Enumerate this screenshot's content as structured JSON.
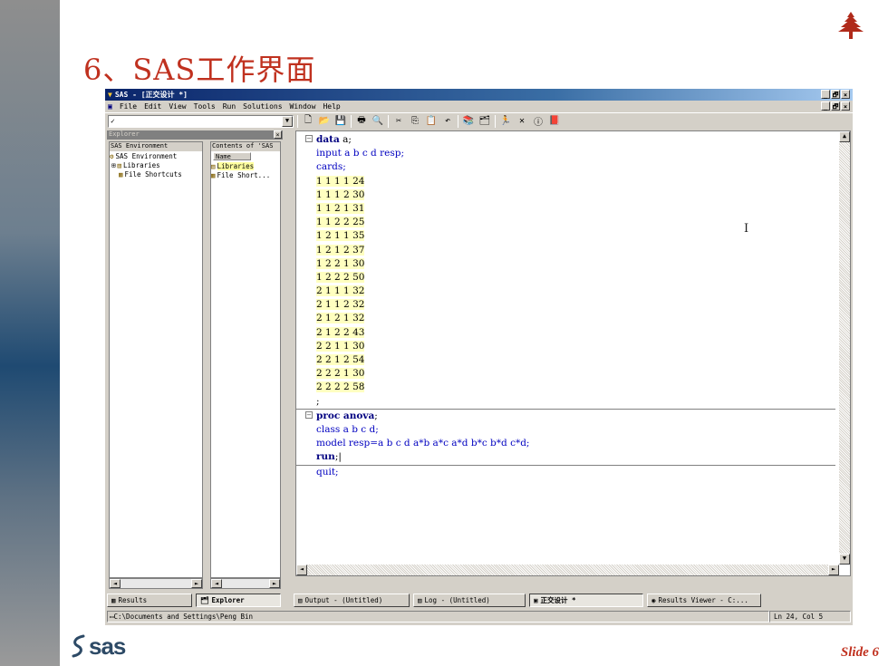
{
  "slide": {
    "title": "6、SAS工作界面",
    "slide_number": "Slide 6",
    "logo_text": "sas",
    "accent_color": "#c0311f"
  },
  "window": {
    "title": "SAS - [正交设计 *]",
    "buttons": [
      "_",
      "🗗",
      "×"
    ],
    "menu": [
      "File",
      "Edit",
      "View",
      "Tools",
      "Run",
      "Solutions",
      "Window",
      "Help"
    ],
    "command_box_value": "✓",
    "toolbar_icons": [
      "new-icon",
      "open-icon",
      "save-icon",
      "print-icon",
      "print-preview-icon",
      "cut-icon",
      "copy-icon",
      "paste-icon",
      "undo-icon",
      "libraries-icon",
      "explorer-icon",
      "run-icon",
      "clear-icon",
      "help-icon",
      "book-icon"
    ]
  },
  "explorer": {
    "title": "Explorer",
    "left_pane_header": "SAS Environment",
    "right_pane_header": "Contents of 'SAS",
    "column_name": "Name",
    "tree": [
      {
        "label": "SAS Environment"
      },
      {
        "label": "Libraries"
      },
      {
        "label": "File Shortcuts"
      }
    ],
    "contents": [
      {
        "label": "Libraries"
      },
      {
        "label": "File Short..."
      }
    ]
  },
  "editor": {
    "lines": [
      {
        "fold": "⊟",
        "parts": [
          {
            "t": "data",
            "c": "kw"
          },
          {
            "t": " a;",
            "c": ""
          }
        ]
      },
      {
        "fold": "",
        "parts": [
          {
            "t": "input a b c d resp;",
            "c": "st"
          }
        ]
      },
      {
        "fold": "",
        "parts": [
          {
            "t": "cards;",
            "c": "st"
          }
        ]
      },
      {
        "fold": "",
        "parts": [
          {
            "t": "1 1 1 1 24",
            "c": "dl"
          }
        ]
      },
      {
        "fold": "",
        "parts": [
          {
            "t": "1 1 1 2 30",
            "c": "dl"
          }
        ]
      },
      {
        "fold": "",
        "parts": [
          {
            "t": "1 1 2 1 31",
            "c": "dl"
          }
        ]
      },
      {
        "fold": "",
        "parts": [
          {
            "t": "1 1 2 2 25",
            "c": "dl"
          }
        ]
      },
      {
        "fold": "",
        "parts": [
          {
            "t": "1 2 1 1 35",
            "c": "dl"
          }
        ]
      },
      {
        "fold": "",
        "parts": [
          {
            "t": "1 2 1 2 37",
            "c": "dl"
          }
        ]
      },
      {
        "fold": "",
        "parts": [
          {
            "t": "1 2 2 1 30",
            "c": "dl"
          }
        ]
      },
      {
        "fold": "",
        "parts": [
          {
            "t": "1 2 2 2 50",
            "c": "dl"
          }
        ]
      },
      {
        "fold": "",
        "parts": [
          {
            "t": "2 1 1 1 32",
            "c": "dl"
          }
        ]
      },
      {
        "fold": "",
        "parts": [
          {
            "t": "2 1 1 2 32",
            "c": "dl"
          }
        ]
      },
      {
        "fold": "",
        "parts": [
          {
            "t": "2 1 2 1 32",
            "c": "dl"
          }
        ]
      },
      {
        "fold": "",
        "parts": [
          {
            "t": "2 1 2 2 43",
            "c": "dl"
          }
        ]
      },
      {
        "fold": "",
        "parts": [
          {
            "t": "2 2 1 1 30",
            "c": "dl"
          }
        ]
      },
      {
        "fold": "",
        "parts": [
          {
            "t": "2 2 1 2 54",
            "c": "dl"
          }
        ]
      },
      {
        "fold": "",
        "parts": [
          {
            "t": "2 2 2 1 30",
            "c": "dl"
          }
        ]
      },
      {
        "fold": "",
        "parts": [
          {
            "t": "2 2 2 2 58",
            "c": "dl"
          }
        ]
      },
      {
        "fold": "",
        "parts": [
          {
            "t": ";",
            "c": ""
          }
        ],
        "sep_after": true
      },
      {
        "fold": "⊟",
        "parts": [
          {
            "t": "proc anova",
            "c": "kw"
          },
          {
            "t": ";",
            "c": ""
          }
        ]
      },
      {
        "fold": "",
        "parts": [
          {
            "t": "class a b c d;",
            "c": "st"
          }
        ]
      },
      {
        "fold": "",
        "parts": [
          {
            "t": "model resp=a b c d a*b a*c a*d b*c b*d c*d;",
            "c": "st"
          }
        ]
      },
      {
        "fold": "",
        "parts": [
          {
            "t": "run",
            "c": "kw"
          },
          {
            "t": ";|",
            "c": ""
          }
        ],
        "sep_after": true
      },
      {
        "fold": "",
        "parts": [
          {
            "t": "quit;",
            "c": "st"
          }
        ]
      }
    ]
  },
  "bottom_tabs": {
    "explorer_tabs": [
      {
        "label": "Results",
        "icon": "results-icon"
      },
      {
        "label": "Explorer",
        "icon": "explorer-icon"
      }
    ],
    "window_tabs": [
      {
        "label": "Output - (Untitled)",
        "icon": "output-icon",
        "active": false
      },
      {
        "label": "Log - (Untitled)",
        "icon": "log-icon",
        "active": false
      },
      {
        "label": "正交设计 *",
        "icon": "editor-icon",
        "active": true
      },
      {
        "label": "Results Viewer - C:...",
        "icon": "results-viewer-icon",
        "active": false
      }
    ]
  },
  "status": {
    "path": "C:\\Documents and Settings\\Peng Bin",
    "position": "Ln 24, Col 5"
  }
}
